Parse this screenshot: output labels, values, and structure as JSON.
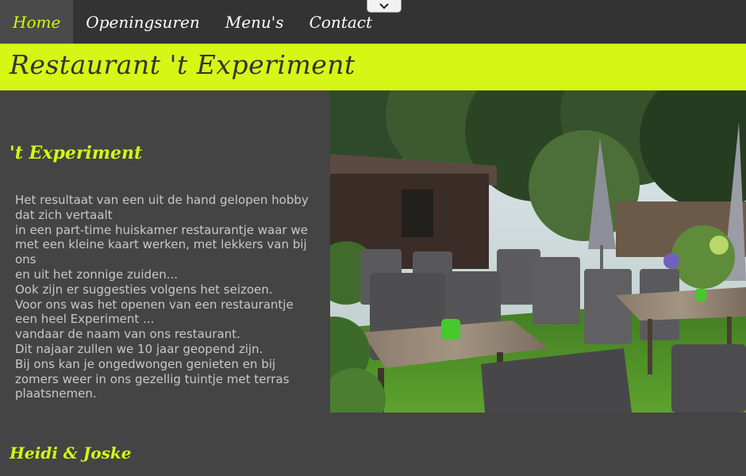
{
  "nav": {
    "items": [
      {
        "label": "Home"
      },
      {
        "label": "Openingsuren"
      },
      {
        "label": "Menu's"
      },
      {
        "label": "Contact"
      }
    ]
  },
  "banner": {
    "title": "Restaurant 't Experiment"
  },
  "content": {
    "subtitle": "'t Experiment",
    "lines": [
      "Het resultaat van een uit de hand gelopen hobby dat zich vertaalt",
      "in een part-time huiskamer restaurantje waar we",
      "met een kleine kaart werken, met lekkers van bij ons",
      "en uit het zonnige zuiden...",
      "Ook zijn er suggesties volgens het seizoen.",
      "Voor ons was het openen van een restaurantje een heel Experiment ...",
      "vandaar de naam van ons restaurant.",
      "Dit najaar zullen we 10 jaar geopend zijn.",
      "Bij ons kan je ongedwongen genieten en bij zomers weer in ons gezellig tuintje met terras plaatsnemen."
    ],
    "signature": "Heidi & Joske"
  },
  "colors": {
    "accent": "#d4f716",
    "nav_bg": "#333333",
    "page_bg": "#444444",
    "text": "#c8c8c8"
  },
  "icons": {
    "collapse": "chevron-down-icon"
  }
}
